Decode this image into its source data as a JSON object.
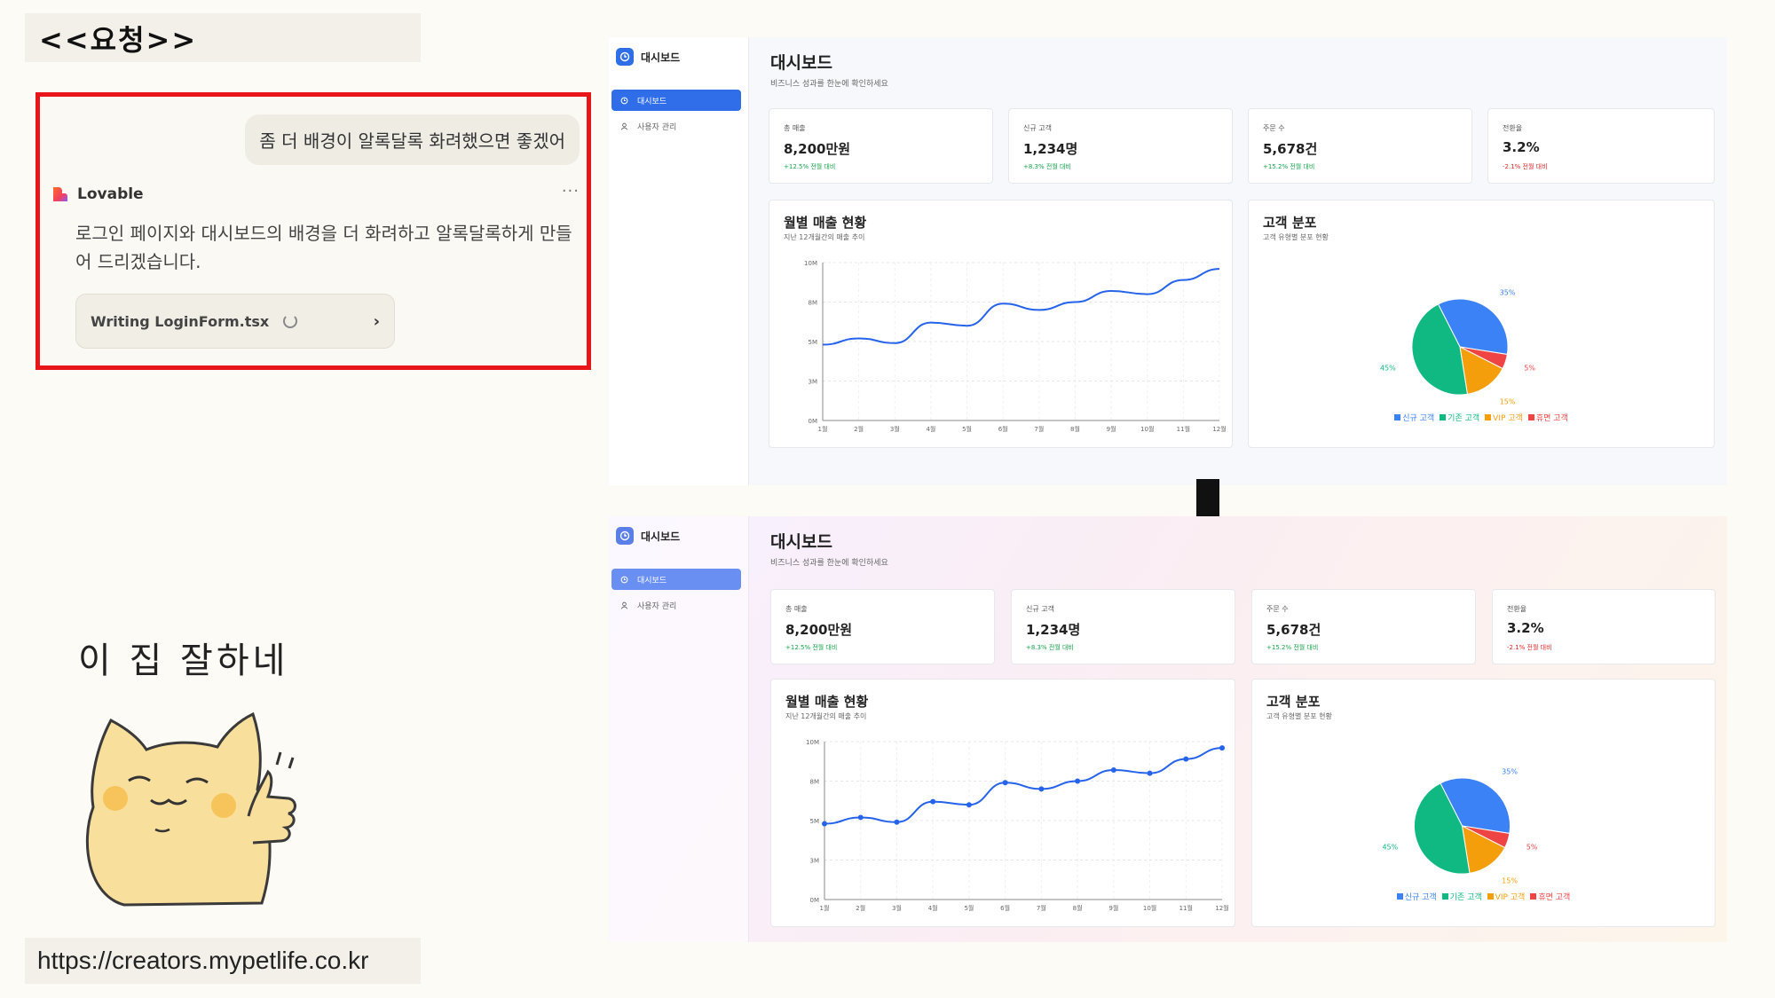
{
  "left": {
    "request_label": "<<요청>>",
    "user_message": "좀 더 배경이 알록달록 화려했으면 좋겠어",
    "assistant_name": "Lovable",
    "assistant_message": "로그인 페이지와 대시보드의 배경을 더 화려하고 알록달록하게 만들어 드리겠습니다.",
    "writing_file": "Writing LoginForm.tsx",
    "praise": "이 집 잘하네",
    "url": "https://creators.mypetlife.co.kr"
  },
  "dashboard": {
    "brand": "대시보드",
    "nav": [
      {
        "label": "대시보드",
        "icon": "clock-icon"
      },
      {
        "label": "사용자 관리",
        "icon": "user-icon"
      }
    ],
    "title": "대시보드",
    "subtitle": "비즈니스 성과를 한눈에 확인하세요",
    "stats": [
      {
        "label": "총 매출",
        "value": "8,200만원",
        "change": "+12.5% 전월 대비"
      },
      {
        "label": "신규 고객",
        "value": "1,234명",
        "change": "+8.3% 전월 대비"
      },
      {
        "label": "주문 수",
        "value": "5,678건",
        "change": "+15.2% 전월 대비"
      },
      {
        "label": "전환율",
        "value": "3.2%",
        "change": "-2.1% 전월 대비"
      }
    ],
    "sales_card": {
      "title": "월별 매출 현황",
      "subtitle": "지난 12개월간의 매출 추이"
    },
    "customer_card": {
      "title": "고객 분포",
      "subtitle": "고객 유형별 분포 현황"
    }
  },
  "chart_data": [
    {
      "type": "line",
      "title": "월별 매출 현황",
      "x": [
        "1월",
        "2월",
        "3월",
        "4월",
        "5월",
        "6월",
        "7월",
        "8월",
        "9월",
        "10월",
        "11월",
        "12월"
      ],
      "y_ticks": [
        "0M",
        "3M",
        "5M",
        "8M",
        "10M"
      ],
      "ylim": [
        0,
        10
      ],
      "series": [
        {
          "values": [
            4.8,
            5.2,
            4.9,
            6.2,
            6.0,
            7.4,
            7.0,
            7.5,
            8.2,
            8.0,
            8.9,
            9.6
          ],
          "color": "#2563eb"
        }
      ]
    },
    {
      "type": "pie",
      "title": "고객 분포",
      "slices": [
        {
          "label": "신규 고객",
          "value": 35,
          "text": "35%",
          "color": "#3b82f6"
        },
        {
          "label": "휴면 고객",
          "value": 5,
          "text": "5%",
          "color": "#ef4444"
        },
        {
          "label": "VIP 고객",
          "value": 15,
          "text": "15%",
          "color": "#f59e0b"
        },
        {
          "label": "기존 고객",
          "value": 45,
          "text": "45%",
          "color": "#10b981"
        }
      ],
      "legend": [
        "신규 고객",
        "기존 고객",
        "VIP 고객",
        "휴면 고객"
      ],
      "legend_colors": [
        "#3b82f6",
        "#10b981",
        "#f59e0b",
        "#ef4444"
      ]
    }
  ]
}
